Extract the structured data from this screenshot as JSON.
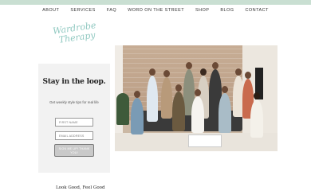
{
  "nav": {
    "items": [
      "About",
      "Services",
      "FAQ",
      "Word on the Street",
      "Shop",
      "Blog",
      "Contact"
    ]
  },
  "brand": {
    "logo_line1": "Wardrobe",
    "logo_line2": "Therapy",
    "accent_color": "#8fc8c0",
    "topbar_color": "#c9dfd2"
  },
  "signup": {
    "title": "Stay in the loop.",
    "subtitle": "Get weekly style tips for real life",
    "first_name_placeholder": "First name",
    "email_placeholder": "Email address",
    "submit_label": "Sign me up! Thank you!"
  },
  "hero": {
    "image_alt": "Group photo of the team on a couch"
  },
  "footer": {
    "tagline": "Look Good, Feel Good"
  }
}
